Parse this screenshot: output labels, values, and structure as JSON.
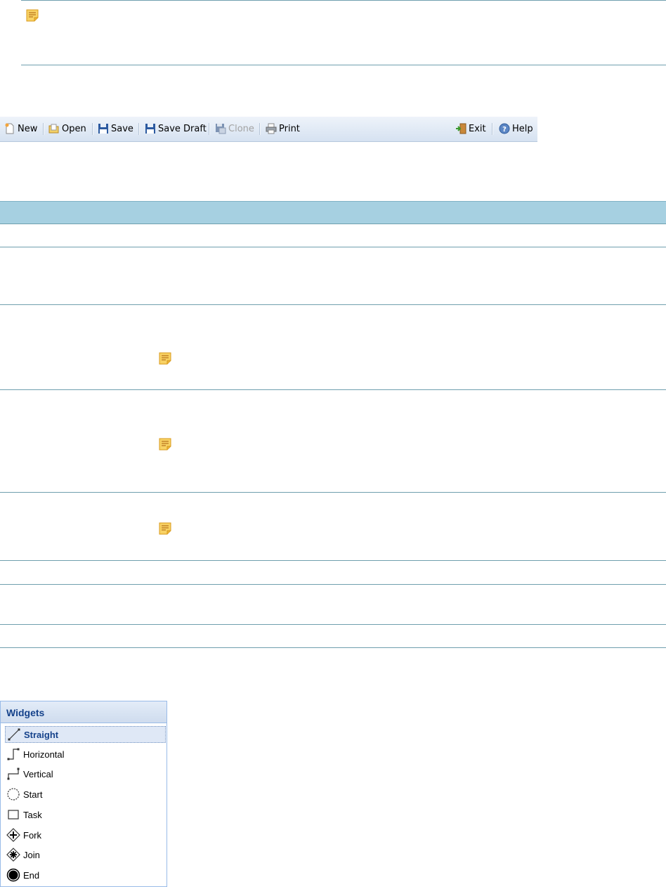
{
  "toolbar": {
    "new_label": "New",
    "open_label": "Open",
    "save_label": "Save",
    "save_draft_label": "Save Draft",
    "clone_label": "Clone",
    "print_label": "Print",
    "exit_label": "Exit",
    "help_label": "Help"
  },
  "widgets": {
    "title": "Widgets",
    "items": [
      {
        "label": "Straight",
        "icon": "straight-line-icon",
        "selected": true
      },
      {
        "label": "Horizontal",
        "icon": "horizontal-connector-icon"
      },
      {
        "label": "Vertical",
        "icon": "vertical-connector-icon"
      },
      {
        "label": "Start",
        "icon": "start-circle-icon"
      },
      {
        "label": "Task",
        "icon": "task-square-icon"
      },
      {
        "label": "Fork",
        "icon": "fork-diamond-icon"
      },
      {
        "label": "Join",
        "icon": "join-diamond-icon"
      },
      {
        "label": "End",
        "icon": "end-circle-icon"
      }
    ]
  },
  "colors": {
    "table_header": "#a6d0e1",
    "row_divider": "#6f9fae",
    "widgets_title": "#15428b",
    "note_icon": "#f5c33b"
  }
}
